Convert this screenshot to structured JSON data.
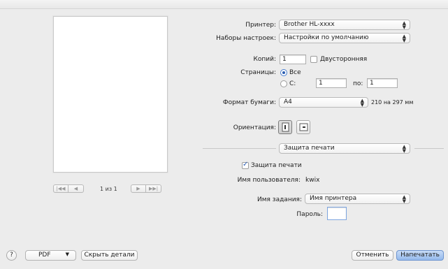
{
  "preview": {
    "nav": {
      "first_label": "|◀◀",
      "prev_label": "◀",
      "next_label": "▶",
      "last_label": "▶▶|",
      "page_info": "1 из 1"
    }
  },
  "printer": {
    "label": "Принтер:",
    "value": "Brother HL-xxxx"
  },
  "presets": {
    "label": "Наборы настроек:",
    "value": "Настройки по умолчанию"
  },
  "copies": {
    "label": "Копий:",
    "value": "1",
    "duplex_label": "Двусторонняя"
  },
  "pages": {
    "label": "Страницы:",
    "all_label": "Все",
    "from_label": "С:",
    "from_value": "1",
    "to_label": "по:",
    "to_value": "1"
  },
  "paper": {
    "label": "Формат бумаги:",
    "value": "A4",
    "size_text": "210 на 297 мм"
  },
  "orientation": {
    "label": "Ориентация:"
  },
  "section": {
    "value": "Защита печати"
  },
  "secure_print": {
    "checkbox_label": "Защита печати",
    "user_label": "Имя пользователя:",
    "user_value": "kwix",
    "job_label": "Имя задания:",
    "job_value": "Имя принтера",
    "password_label": "Пароль:",
    "password_value": ""
  },
  "footer": {
    "help_label": "?",
    "pdf_label": "PDF",
    "hide_details_label": "Скрыть детали",
    "cancel_label": "Отменить",
    "print_label": "Напечатать"
  }
}
